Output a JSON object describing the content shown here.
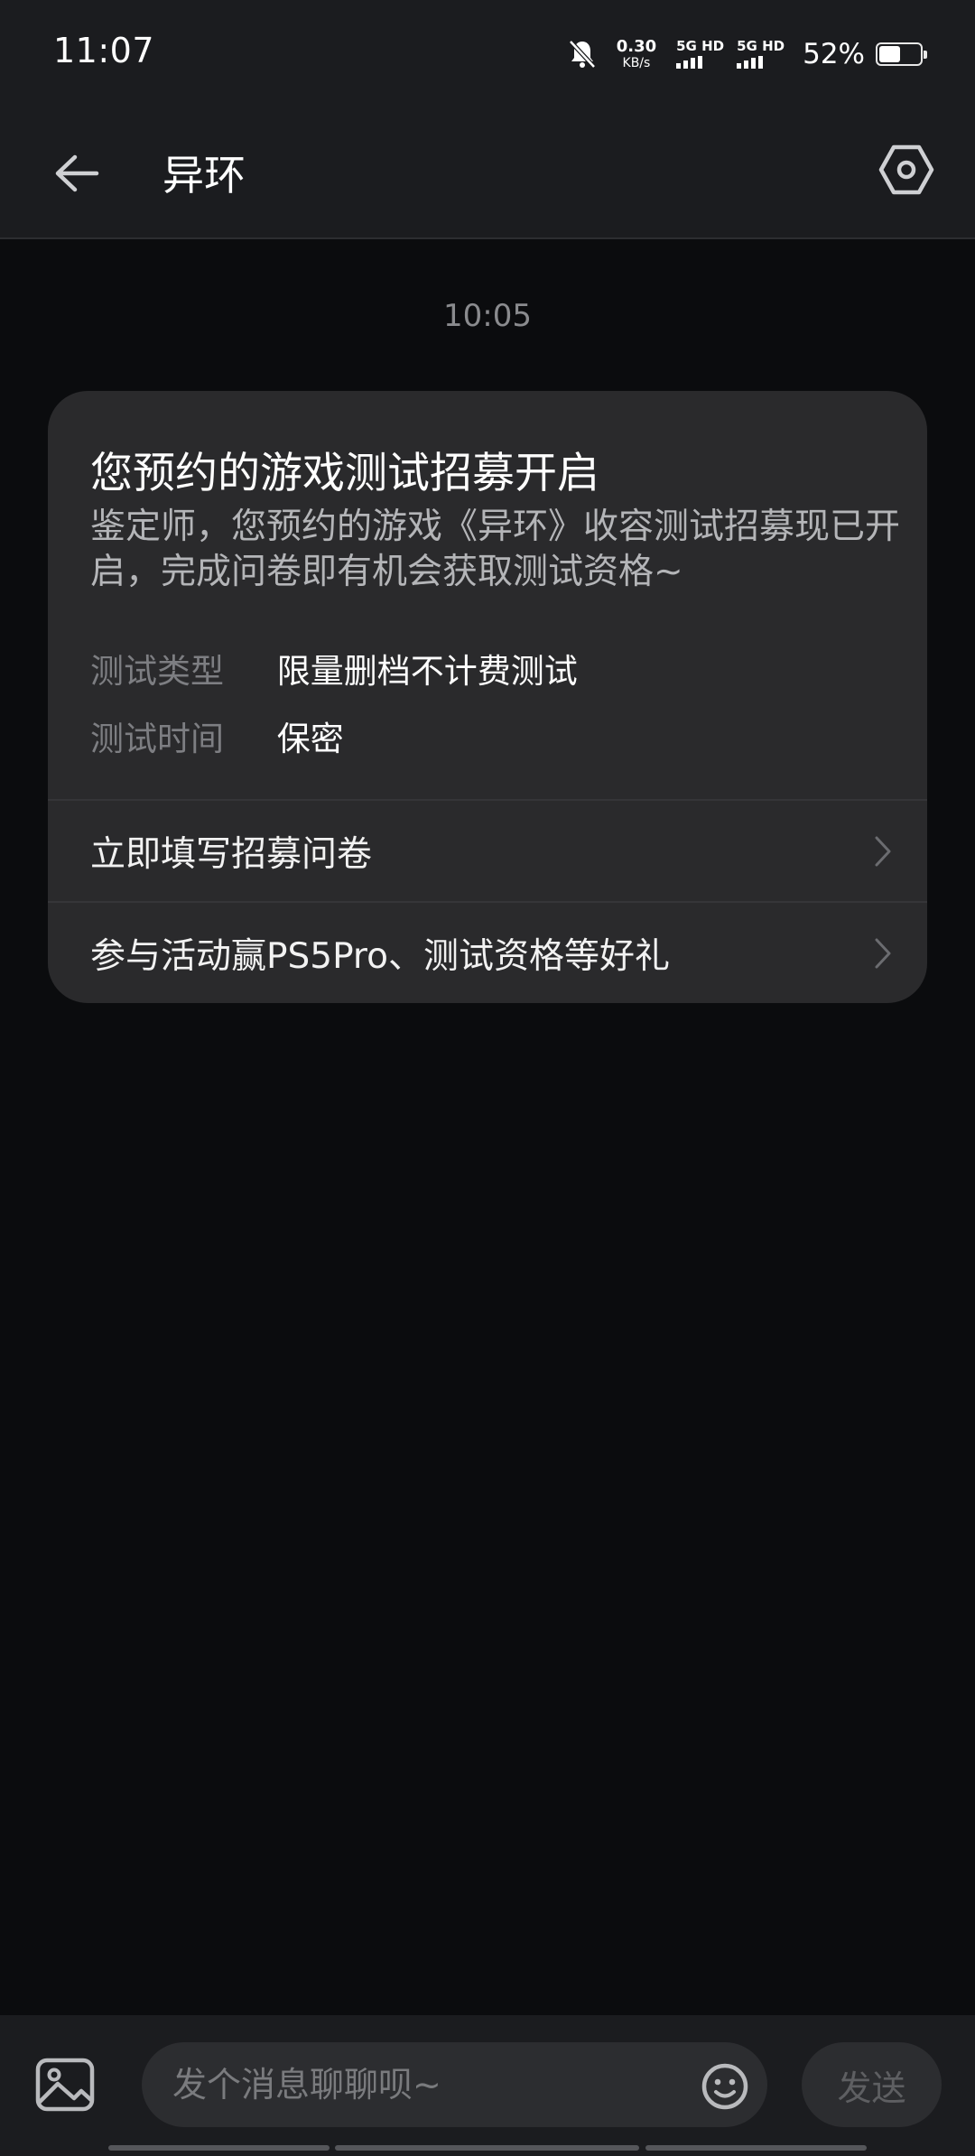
{
  "status_bar": {
    "time": "11:07",
    "net_speed_value": "0.30",
    "net_speed_unit": "KB/s",
    "sim1_label": "5G HD",
    "sim2_label": "5G HD",
    "battery_percent": "52%",
    "battery_level": 0.52
  },
  "header": {
    "title": "异环"
  },
  "chat": {
    "timestamp": "10:05",
    "card": {
      "title": "您预约的游戏测试招募开启",
      "description": "鉴定师，您预约的游戏《异环》收容测试招募现已开启，完成问卷即有机会获取测试资格~",
      "fields": [
        {
          "key": "测试类型",
          "value": "限量删档不计费测试"
        },
        {
          "key": "测试时间",
          "value": "保密"
        }
      ],
      "links": [
        {
          "label": "立即填写招募问卷"
        },
        {
          "label": "参与活动赢PS5Pro、测试资格等好礼"
        }
      ]
    }
  },
  "input_bar": {
    "placeholder": "发个消息聊聊呗~",
    "send_label": "发送"
  }
}
